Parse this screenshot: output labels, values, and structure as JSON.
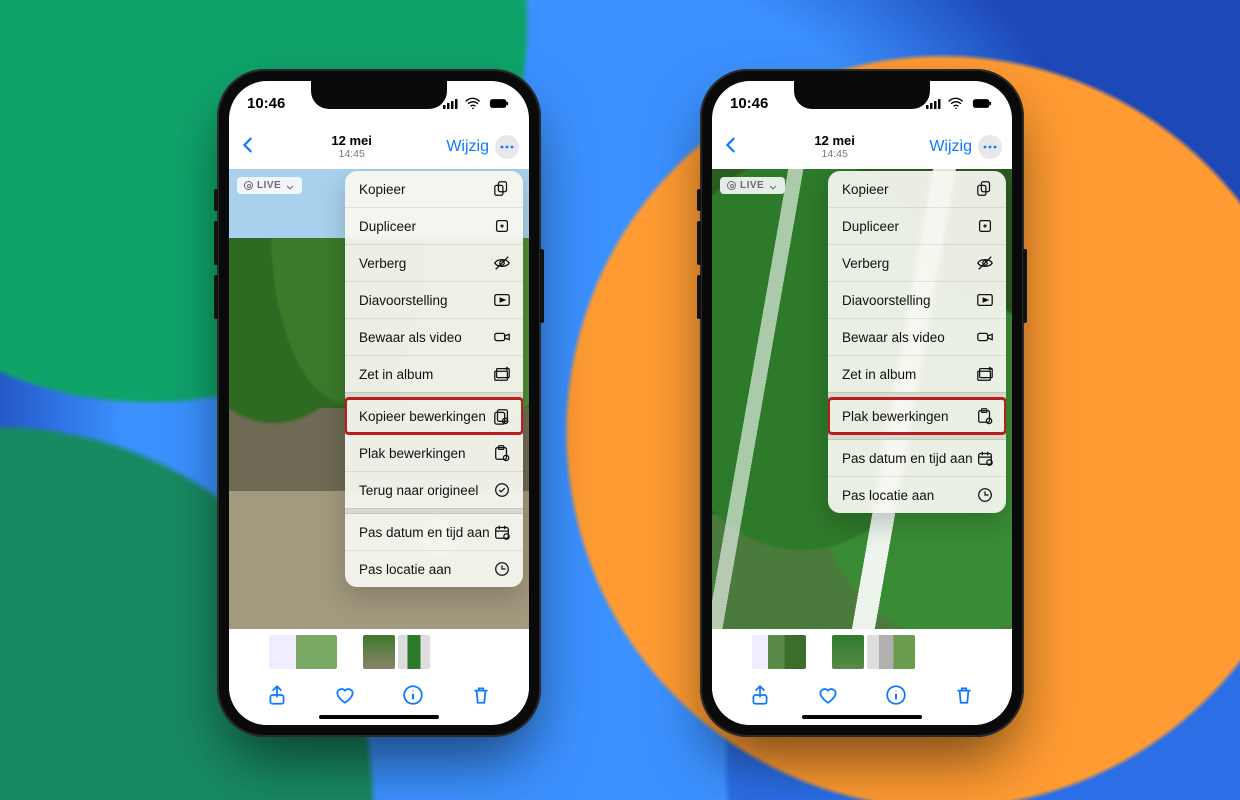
{
  "status": {
    "time": "10:46",
    "live_badge": "LIVE"
  },
  "header": {
    "date": "12 mei",
    "time": "14:45",
    "edit_label": "Wijzig"
  },
  "menu_left": {
    "highlight_index": 6,
    "items": [
      {
        "label": "Kopieer",
        "icon": "copy",
        "group_end": false
      },
      {
        "label": "Dupliceer",
        "icon": "duplicate",
        "group_end": false
      },
      {
        "label": "Verberg",
        "icon": "eye-slash",
        "group_end": false
      },
      {
        "label": "Diavoorstelling",
        "icon": "play-rect",
        "group_end": false
      },
      {
        "label": "Bewaar als video",
        "icon": "video",
        "group_end": false
      },
      {
        "label": "Zet in album",
        "icon": "album-add",
        "group_end": true
      },
      {
        "label": "Kopieer bewerkingen",
        "icon": "edits-copy",
        "group_end": false
      },
      {
        "label": "Plak bewerkingen",
        "icon": "edits-paste",
        "group_end": false
      },
      {
        "label": "Terug naar origineel",
        "icon": "revert",
        "group_end": true
      },
      {
        "label": "Pas datum en tijd aan",
        "icon": "calendar",
        "group_end": false
      },
      {
        "label": "Pas locatie aan",
        "icon": "location",
        "group_end": false
      }
    ]
  },
  "menu_right": {
    "highlight_index": 6,
    "items": [
      {
        "label": "Kopieer",
        "icon": "copy",
        "group_end": false
      },
      {
        "label": "Dupliceer",
        "icon": "duplicate",
        "group_end": false
      },
      {
        "label": "Verberg",
        "icon": "eye-slash",
        "group_end": false
      },
      {
        "label": "Diavoorstelling",
        "icon": "play-rect",
        "group_end": false
      },
      {
        "label": "Bewaar als video",
        "icon": "video",
        "group_end": false
      },
      {
        "label": "Zet in album",
        "icon": "album-add",
        "group_end": true
      },
      {
        "label": "Plak bewerkingen",
        "icon": "edits-paste",
        "group_end": true
      },
      {
        "label": "Pas datum en tijd aan",
        "icon": "calendar",
        "group_end": false
      },
      {
        "label": "Pas locatie aan",
        "icon": "location",
        "group_end": false
      }
    ]
  }
}
